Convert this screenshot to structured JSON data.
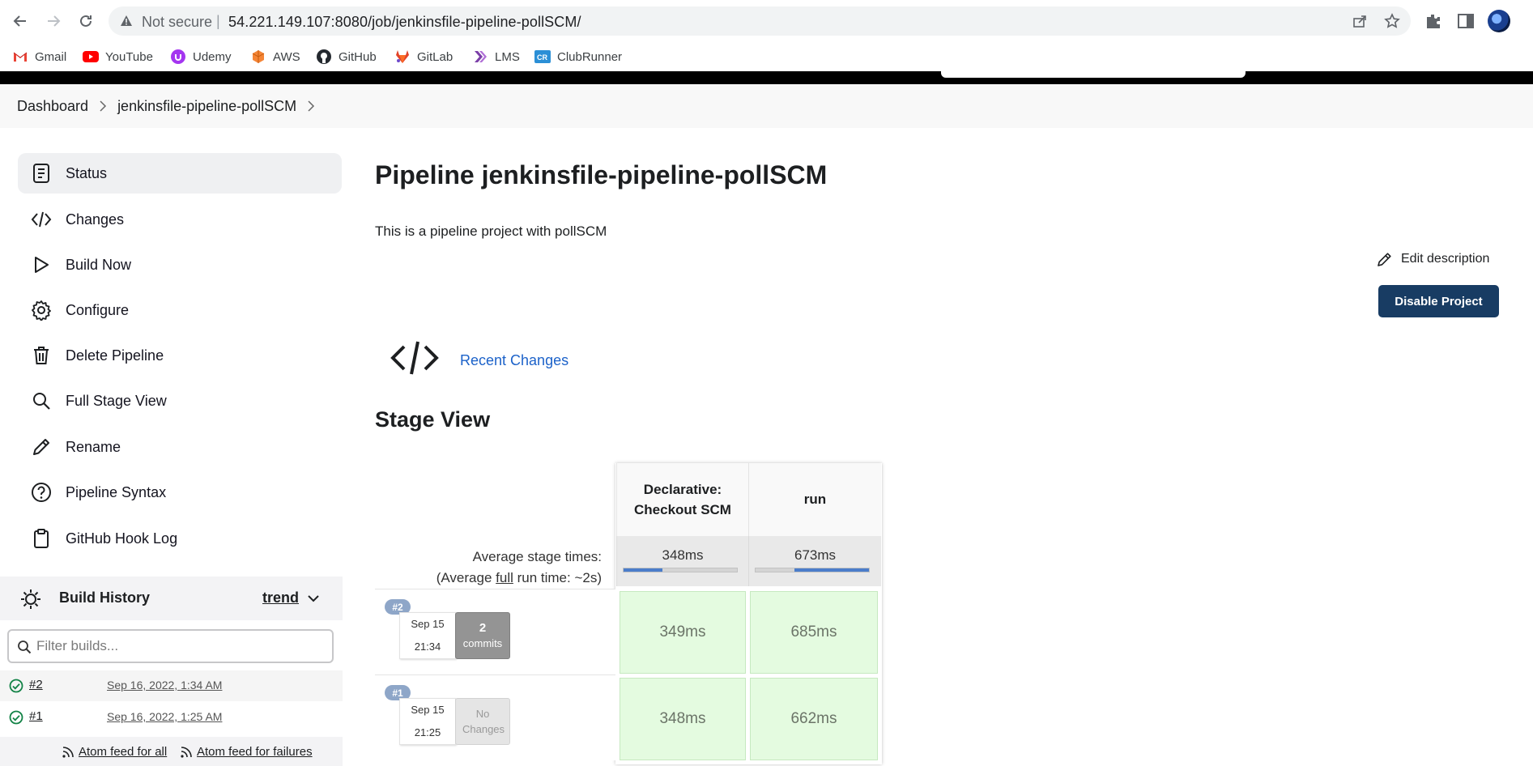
{
  "browser": {
    "security_label": "Not secure",
    "url": "54.221.149.107:8080/job/jenkinsfile-pipeline-pollSCM/",
    "bookmarks": [
      {
        "label": "Gmail",
        "icon": "gmail-icon"
      },
      {
        "label": "YouTube",
        "icon": "youtube-icon"
      },
      {
        "label": "Udemy",
        "icon": "udemy-icon"
      },
      {
        "label": "AWS",
        "icon": "aws-icon"
      },
      {
        "label": "GitHub",
        "icon": "github-icon"
      },
      {
        "label": "GitLab",
        "icon": "gitlab-icon"
      },
      {
        "label": "LMS",
        "icon": "lms-icon"
      },
      {
        "label": "ClubRunner",
        "icon": "clubrunner-icon"
      }
    ]
  },
  "breadcrumb": {
    "items": [
      "Dashboard",
      "jenkinsfile-pipeline-pollSCM"
    ]
  },
  "sidebar": {
    "tasks": [
      {
        "label": "Status",
        "icon": "status-icon"
      },
      {
        "label": "Changes",
        "icon": "code-icon"
      },
      {
        "label": "Build Now",
        "icon": "play-icon"
      },
      {
        "label": "Configure",
        "icon": "gear-icon"
      },
      {
        "label": "Delete Pipeline",
        "icon": "trash-icon"
      },
      {
        "label": "Full Stage View",
        "icon": "search-icon"
      },
      {
        "label": "Rename",
        "icon": "pencil-icon"
      },
      {
        "label": "Pipeline Syntax",
        "icon": "help-icon"
      },
      {
        "label": "GitHub Hook Log",
        "icon": "clipboard-icon"
      }
    ],
    "build_history": {
      "title": "Build History",
      "trend_label": "trend",
      "filter_placeholder": "Filter builds...",
      "builds": [
        {
          "number": "#2",
          "date": "Sep 16, 2022, 1:34 AM",
          "status": "success"
        },
        {
          "number": "#1",
          "date": "Sep 16, 2022, 1:25 AM",
          "status": "success"
        }
      ],
      "atom_all": "Atom feed for all",
      "atom_failures": "Atom feed for failures"
    }
  },
  "main": {
    "title": "Pipeline jenkinsfile-pipeline-pollSCM",
    "description": "This is a pipeline project with pollSCM",
    "edit_description": "Edit description",
    "disable_button": "Disable Project",
    "recent_changes": "Recent Changes",
    "stage_view_heading": "Stage View"
  },
  "stage_view": {
    "avg_label_line1": "Average stage times:",
    "avg_label_prefix": "(Average ",
    "avg_label_full": "full",
    "avg_label_suffix": " run time: ~2s)",
    "stages": [
      {
        "name_line1": "Declarative:",
        "name_line2": "Checkout SCM",
        "avg": "348ms",
        "avg_fraction": 0.34
      },
      {
        "name_line1": "run",
        "name_line2": "",
        "avg": "673ms",
        "avg_fraction": 0.66
      }
    ],
    "runs": [
      {
        "badge": "#2",
        "date": "Sep 15",
        "time": "21:34",
        "commits_count": "2",
        "commits_label": "commits",
        "has_changes": true,
        "durations": [
          "349ms",
          "685ms"
        ]
      },
      {
        "badge": "#1",
        "date": "Sep 15",
        "time": "21:25",
        "commits_count": "",
        "commits_label": "No Changes",
        "has_changes": false,
        "durations": [
          "348ms",
          "662ms"
        ]
      }
    ]
  },
  "colors": {
    "accent_link": "#1c62c9",
    "disable_button_bg": "#183c63",
    "stage_success_bg": "#e4fbe0",
    "success_icon": "#138347"
  }
}
